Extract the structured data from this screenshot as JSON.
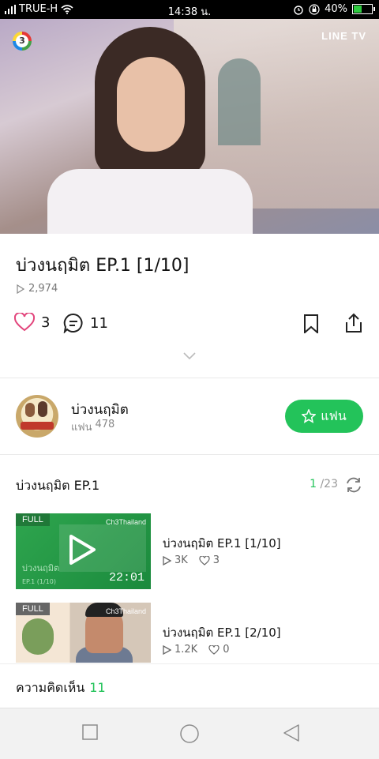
{
  "status_bar": {
    "carrier": "TRUE-H",
    "time": "14:38 น.",
    "battery": "40%",
    "battery_level": 0.4
  },
  "player": {
    "channel_logo": "3",
    "brand": "LINE TV"
  },
  "video": {
    "title": "บ่วงนฤมิต EP.1 [1/10]",
    "views": "2,974",
    "likes": "3",
    "comments": "11"
  },
  "channel": {
    "name": "บ่วงนฤมิต",
    "fans_label": "แฟน",
    "fans_count": "478",
    "fan_button": "แฟน"
  },
  "playlist": {
    "title": "บ่วงนฤมิต EP.1",
    "current": "1",
    "total": "/23",
    "episodes": [
      {
        "title": "บ่วงนฤมิต EP.1 [1/10]",
        "views": "3K",
        "likes": "3",
        "badge": "FULL",
        "duration": "22:01",
        "channel_mark": "Ch3Thailand",
        "caption": "บ่วงนฤมิต",
        "caption_sub": "EP.1 (1/10)"
      },
      {
        "title": "บ่วงนฤมิต EP.1 [2/10]",
        "views": "1.2K",
        "likes": "0",
        "badge": "FULL",
        "channel_mark": "Ch3Thailand"
      }
    ]
  },
  "comments_bar": {
    "label": "ความคิดเห็น",
    "count": "11"
  },
  "colors": {
    "accent": "#23c35a",
    "like_pink": "#e2457c"
  },
  "icons": [
    "wifi-icon",
    "signal-icon",
    "alarm-icon",
    "lock-icon",
    "battery-icon",
    "play-icon",
    "heart-icon",
    "comment-icon",
    "bookmark-icon",
    "share-icon",
    "chevron-down-icon",
    "star-icon",
    "refresh-icon",
    "square-nav-icon",
    "home-nav-icon",
    "back-nav-icon"
  ]
}
